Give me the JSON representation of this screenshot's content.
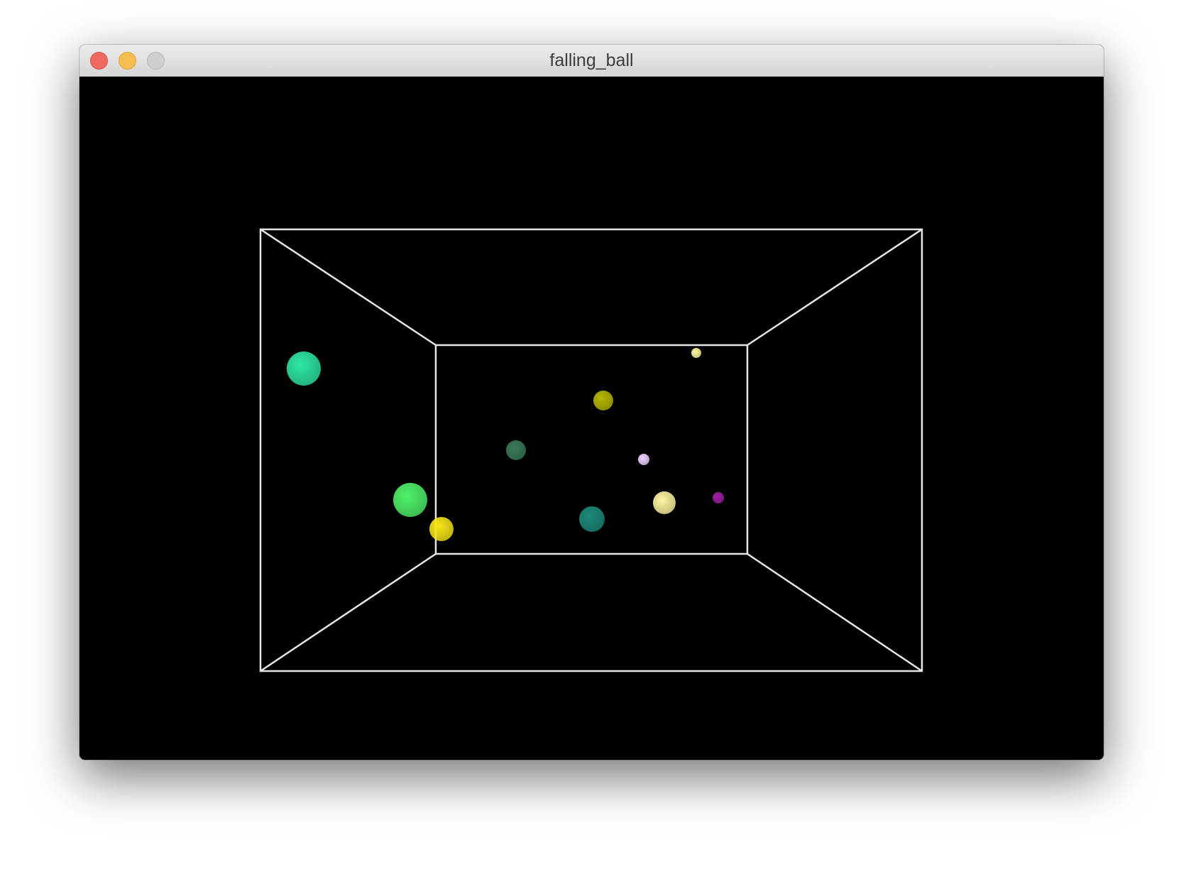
{
  "window": {
    "title": "falling_ball",
    "controls": {
      "close": "close-icon",
      "minimize": "minimize-icon",
      "zoom": "zoom-icon"
    }
  },
  "scene": {
    "background": "#000000",
    "box_edge_color": "#e6e6e6",
    "balls": [
      {
        "color": "#2ee8a2"
      },
      {
        "color": "#4ff26a"
      },
      {
        "color": "#f7e619"
      },
      {
        "color": "#b5b800"
      },
      {
        "color": "#3a7a5a"
      },
      {
        "color": "#f0d0ff"
      },
      {
        "color": "#fdf59a"
      },
      {
        "color": "#fff4a0"
      },
      {
        "color": "#1e8a7a"
      },
      {
        "color": "#a020a8"
      }
    ]
  }
}
